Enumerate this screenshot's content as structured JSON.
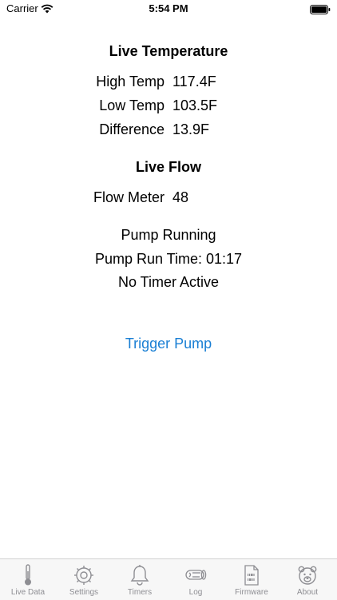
{
  "status_bar": {
    "carrier": "Carrier",
    "time": "5:54 PM"
  },
  "live_temperature": {
    "heading": "Live Temperature",
    "rows": [
      {
        "label": "High Temp",
        "value": "117.4F"
      },
      {
        "label": "Low Temp",
        "value": "103.5F"
      },
      {
        "label": "Difference",
        "value": "13.9F"
      }
    ]
  },
  "live_flow": {
    "heading": "Live Flow",
    "flow_meter_label": "Flow Meter",
    "flow_meter_value": "48"
  },
  "pump": {
    "status": "Pump Running",
    "run_time": "Pump Run Time: 01:17",
    "timer_status": "No Timer Active",
    "trigger_label": "Trigger Pump"
  },
  "colors": {
    "accent": "#1a7fd4",
    "tab_inactive": "#8e8e93"
  },
  "tabs": [
    {
      "label": "Live Data",
      "icon": "thermometer-icon"
    },
    {
      "label": "Settings",
      "icon": "gear-icon"
    },
    {
      "label": "Timers",
      "icon": "bell-icon"
    },
    {
      "label": "Log",
      "icon": "log-icon"
    },
    {
      "label": "Firmware",
      "icon": "firmware-file-icon"
    },
    {
      "label": "About",
      "icon": "bear-icon"
    }
  ]
}
